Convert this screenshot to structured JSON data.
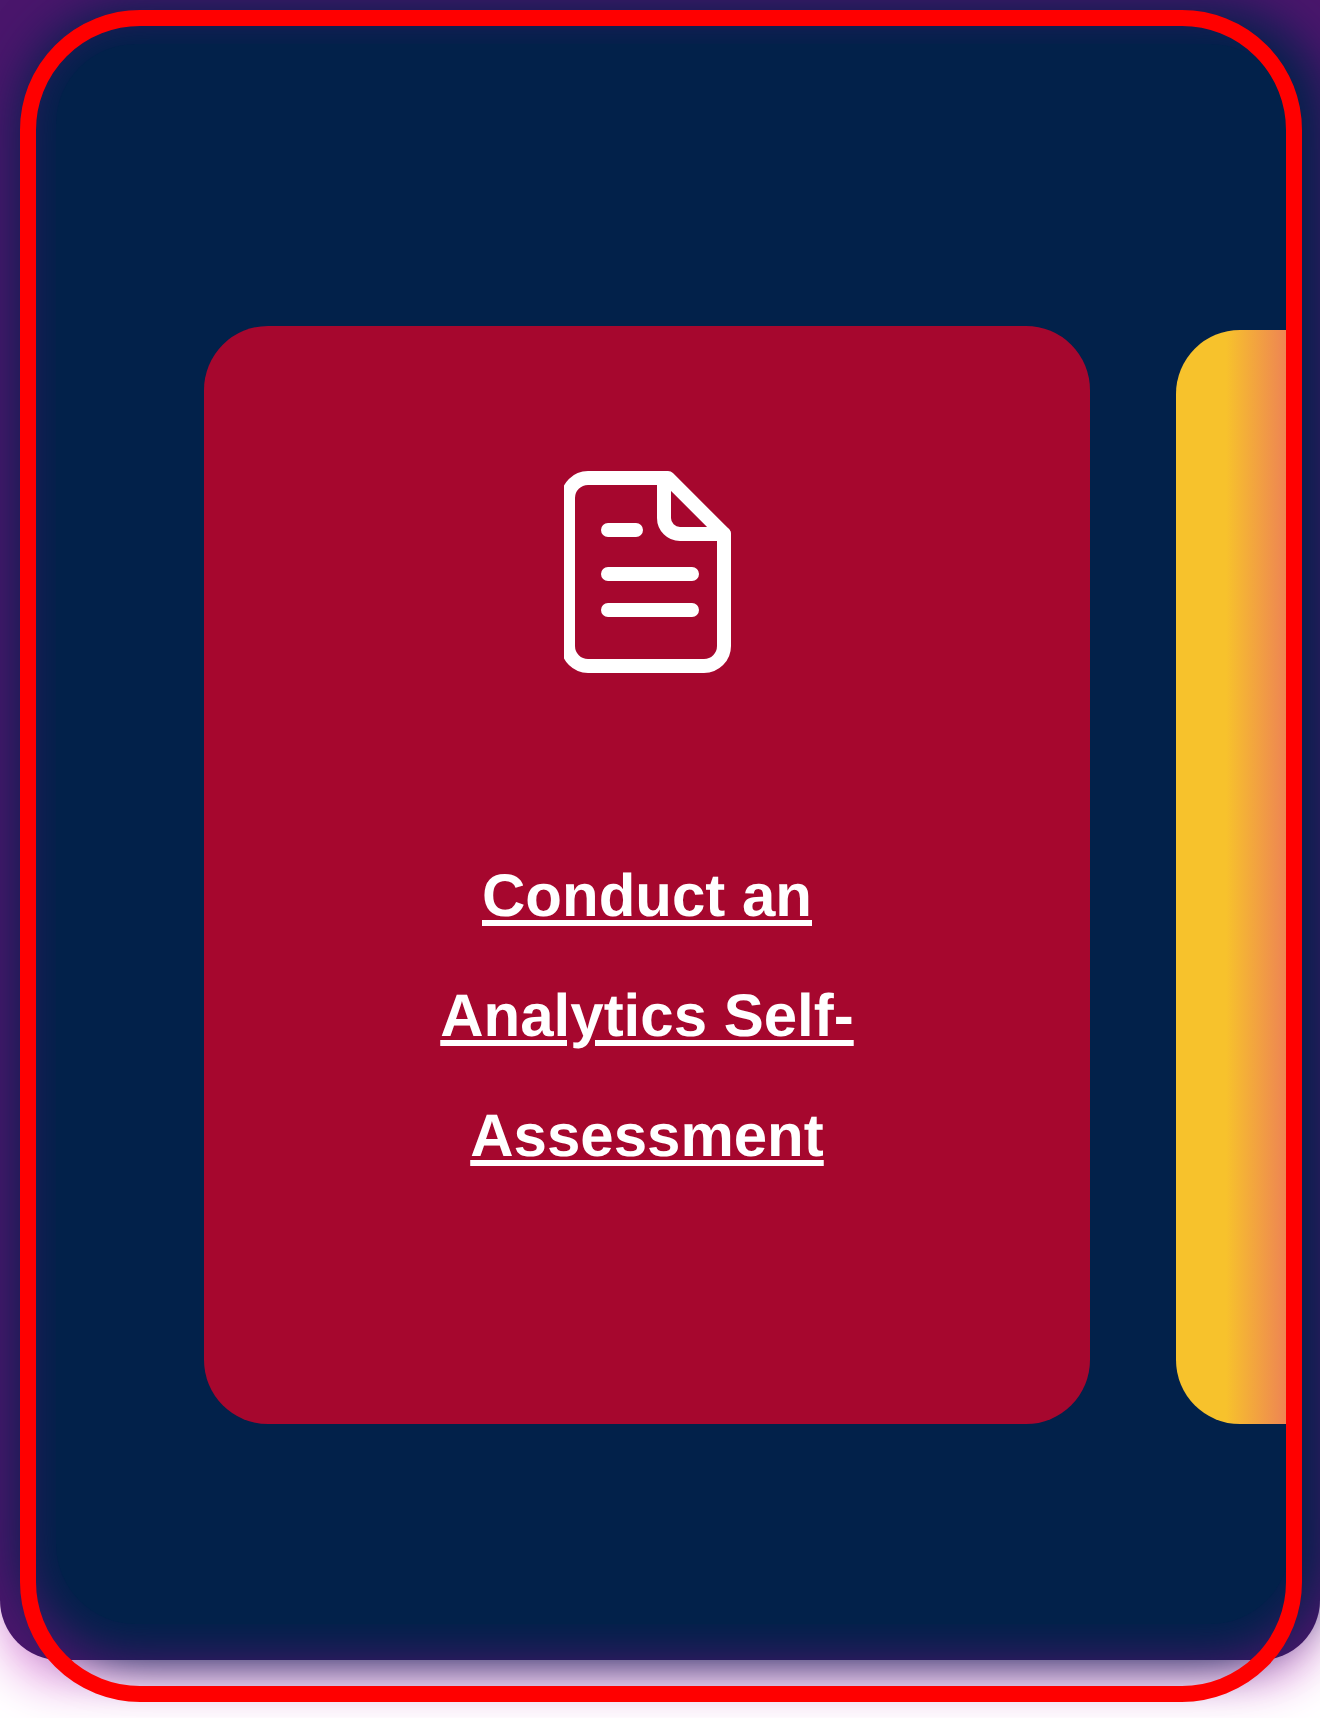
{
  "cards": [
    {
      "kind": "link",
      "title": "Conduct an Analytics Self-Assessment",
      "color": "#a6072e"
    },
    {
      "kind": "partial",
      "color": "#f7c22c"
    }
  ]
}
